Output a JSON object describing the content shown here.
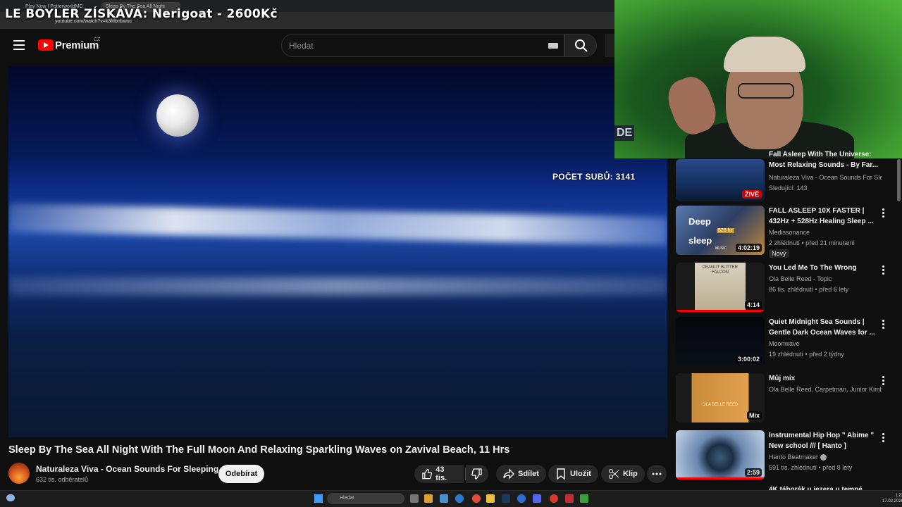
{
  "browser": {
    "tabs": [
      "Play Now | PotterworldMC",
      "Sleep By The Sea All Night"
    ],
    "url": "youtube.com/watch?v=k3ftfbnbwuc"
  },
  "overlay_title": "LE BOYLER ZÍSKÁVÁ: Nerigoat - 2600Kč",
  "header": {
    "logo_text": "Premium",
    "region": "CZ",
    "search_placeholder": "Hledat"
  },
  "video": {
    "subscriber_overlay": "POČET SUBŮ: 3141",
    "title": "Sleep By The Sea All Night With The Full Moon And Relaxing Sparkling Waves on Zavival Beach, 11 Hrs"
  },
  "channel": {
    "name": "Naturaleza Viva - Ocean Sounds For Sleeping",
    "subscribers": "632 tis. odběratelů",
    "subscribe_label": "Odebírat"
  },
  "actions": {
    "likes": "43 tis.",
    "share": "Sdílet",
    "save": "Uložit",
    "clip": "Klip"
  },
  "cam": {
    "overlay_text": "DE"
  },
  "sidebar": [
    {
      "title": "Fall Asleep With The Universe: Most Relaxing Sounds - By Far...",
      "channel": "Naturaleza Viva - Ocean Sounds For Slee...",
      "meta": "Sledující: 143",
      "badge": "ŽIVĚ"
    },
    {
      "title": "FALL ASLEEP 10X FASTER | 432Hz + 528Hz Healing Sleep ...",
      "channel": "Medissonance",
      "meta": "2 zhlédnutí • před 21 minutami",
      "duration": "4:02:19",
      "new": "Nový",
      "thumb_text": [
        "Deep",
        "528 hz",
        "sleep",
        "MUSIC"
      ]
    },
    {
      "title": "You Led Me To The Wrong",
      "channel": "Ola Belle Reed - Topic",
      "meta": "86 tis. zhlédnutí • před 6 lety",
      "duration": "4:14",
      "thumb_text": [
        "PEANUT BUTTER",
        "FALCON"
      ]
    },
    {
      "title": "Quiet Midnight Sea Sounds | Gentle Dark Ocean Waves for ...",
      "channel": "Moonwave",
      "meta": "19 zhlédnutí • před 2 týdny",
      "duration": "3:00:02"
    },
    {
      "title": "Můj mix",
      "channel": "Ola Belle Reed, Carpetman, Junior Kimbr...",
      "duration": "Mix",
      "thumb_text": [
        "OLA BELLE REED"
      ]
    },
    {
      "title": "Instrumental Hip Hop \" Abime \" New school /// [ Hanto ]",
      "channel": "Hanto Beatmaker",
      "meta": "591 tis. zhlédnutí • před 8 lety",
      "duration": "2:59"
    },
    {
      "title": "4K táborák u jezera u tempé..."
    }
  ],
  "taskbar": {
    "search": "Hledat",
    "time": "1:23",
    "date": "17.02.2026"
  }
}
